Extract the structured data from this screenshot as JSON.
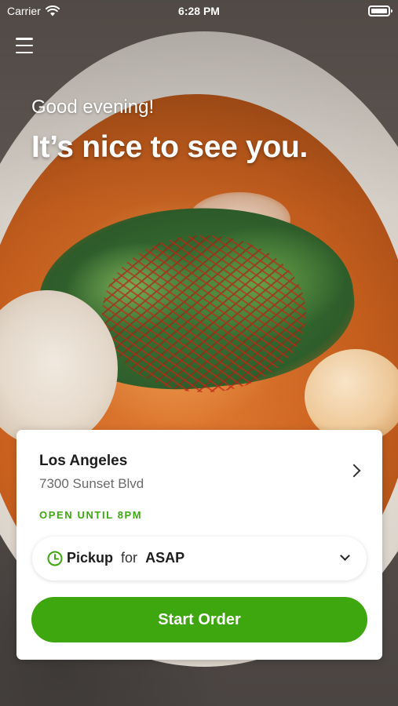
{
  "status_bar": {
    "carrier": "Carrier",
    "time": "6:28 PM"
  },
  "hero": {
    "greeting": "Good evening!",
    "headline": "It’s nice to see you."
  },
  "location": {
    "name": "Los Angeles",
    "address": "7300 Sunset Blvd",
    "hours_status": "OPEN UNTIL 8PM"
  },
  "order_mode": {
    "mode": "Pickup",
    "connector": "for",
    "time": "ASAP"
  },
  "actions": {
    "start_order": "Start Order"
  },
  "colors": {
    "accent": "#3ea60e",
    "status_open": "#3aaa0e"
  },
  "icons": [
    "menu-icon",
    "wifi-icon",
    "battery-icon",
    "chevron-right-icon",
    "clock-icon",
    "chevron-down-icon"
  ]
}
